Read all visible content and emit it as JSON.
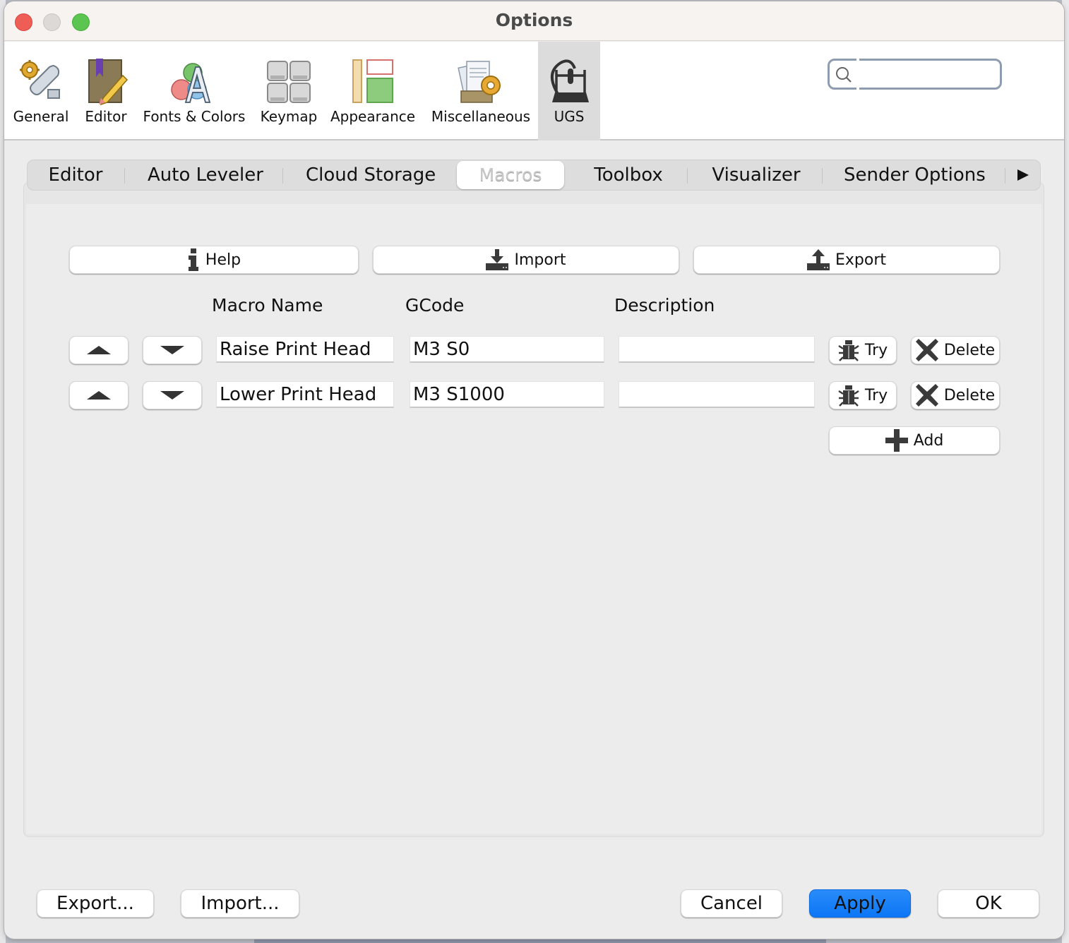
{
  "window": {
    "title": "Options"
  },
  "categories": [
    {
      "label": "General",
      "icon": "gear-wrench-icon",
      "selected": false
    },
    {
      "label": "Editor",
      "icon": "book-pencil-icon",
      "selected": false
    },
    {
      "label": "Fonts & Colors",
      "icon": "font-colors-icon",
      "selected": false
    },
    {
      "label": "Keymap",
      "icon": "keyboard-keys-icon",
      "selected": false
    },
    {
      "label": "Appearance",
      "icon": "layout-panels-icon",
      "selected": false
    },
    {
      "label": "Miscellaneous",
      "icon": "documents-gear-icon",
      "selected": false
    },
    {
      "label": "UGS",
      "icon": "cnc-machine-icon",
      "selected": true
    }
  ],
  "search": {
    "value": "",
    "placeholder": ""
  },
  "tabs": [
    {
      "label": "Editor",
      "active": false
    },
    {
      "label": "Auto Leveler",
      "active": false
    },
    {
      "label": "Cloud Storage",
      "active": false
    },
    {
      "label": "Macros",
      "active": true
    },
    {
      "label": "Toolbox",
      "active": false
    },
    {
      "label": "Visualizer",
      "active": false
    },
    {
      "label": "Sender Options",
      "active": false
    }
  ],
  "tab_more_icon": "triangle-right-icon",
  "macros": {
    "toolbar": {
      "help_label": "Help",
      "import_label": "Import",
      "export_label": "Export"
    },
    "columns": {
      "name": "Macro Name",
      "gcode": "GCode",
      "description": "Description"
    },
    "rows": [
      {
        "name": "Raise Print Head",
        "gcode": "M3 S0",
        "description": "",
        "try_label": "Try",
        "delete_label": "Delete"
      },
      {
        "name": "Lower Print Head",
        "gcode": "M3 S1000",
        "description": "",
        "try_label": "Try",
        "delete_label": "Delete"
      }
    ],
    "add_label": "Add"
  },
  "footer": {
    "export_label": "Export...",
    "import_label": "Import...",
    "cancel_label": "Cancel",
    "apply_label": "Apply",
    "ok_label": "OK"
  },
  "colors": {
    "accent": "#1a82f7",
    "selected_category_bg": "#dcdcdc",
    "window_bg": "#ececec"
  }
}
